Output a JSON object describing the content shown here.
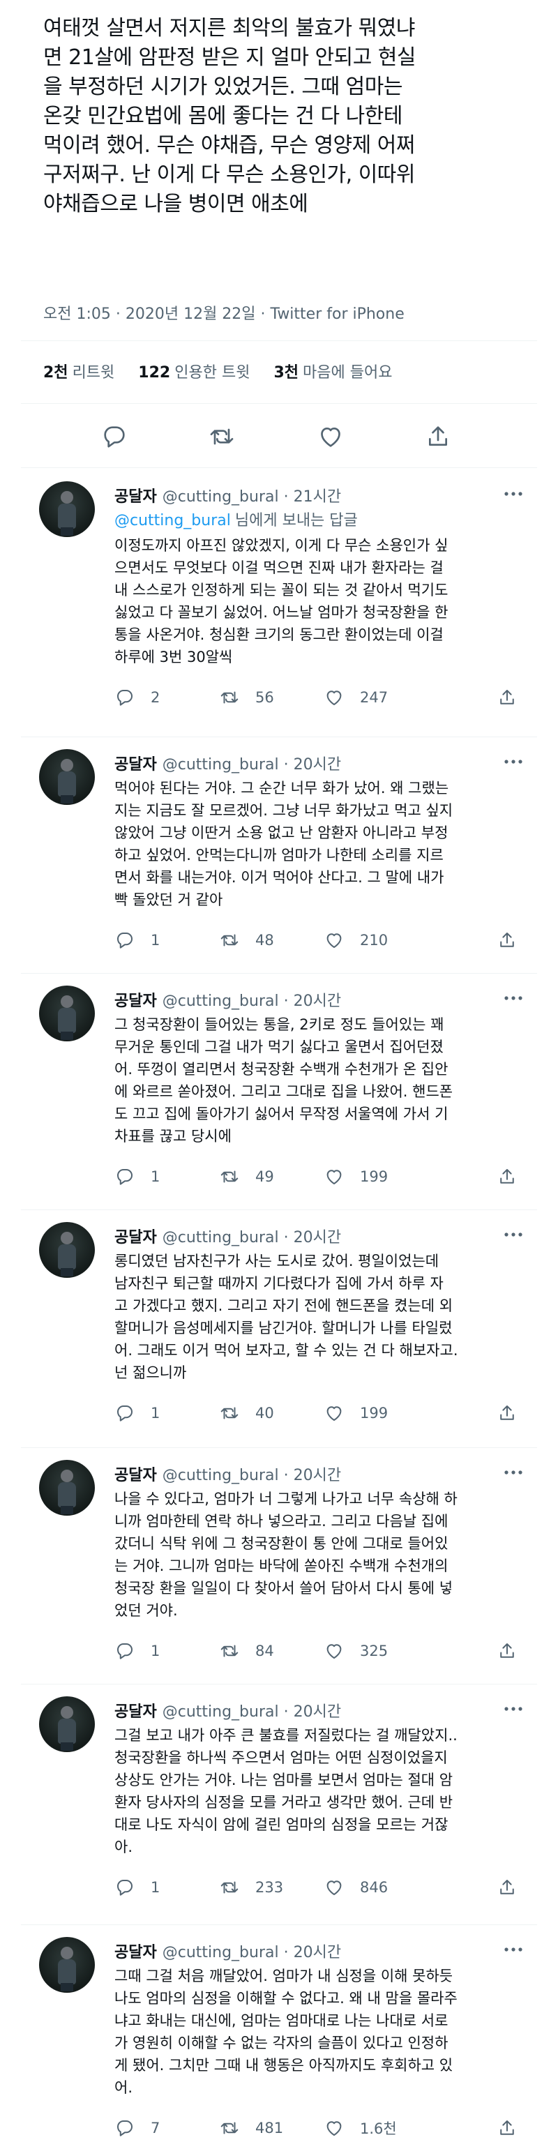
{
  "tweet": {
    "lines": [
      "여태껏 살면서 저지른 최악의 불효가 뭐였냐",
      "면 21살에 암판정 받은 지 얼마 안되고 현실",
      "을 부정하던 시기가 있었거든. 그때 엄마는",
      "온갖 민간요법에 몸에 좋다는 건 다 나한테",
      "먹이려 했어. 무슨 야채즙, 무슨 영양제 어쩌",
      "구저쩌구. 난 이게 다 무슨 소용인가, 이따위",
      "야채즙으로 나을 병이면 애초에"
    ],
    "meta": "오전 1:05 · 2020년 12월 22일 · Twitter for iPhone",
    "stats": {
      "retweets_num": "2천",
      "retweets_label": "리트윗",
      "quotes_num": "122",
      "quotes_label": "인용한 트윗",
      "likes_num": "3천",
      "likes_label": "마음에 들어요"
    }
  },
  "replies": [
    {
      "name": "공달자",
      "handle": "@cutting_bural",
      "time": "· 21시간",
      "replying_to": "@cutting_bural",
      "replying_suffix": "님에게 보내는 답글",
      "lines": [
        "이정도까지 아프진 않았겠지, 이게 다 무슨 소용인가 싶",
        "으면서도 무엇보다 이걸 먹으면 진짜 내가 환자라는 걸",
        "내 스스로가 인정하게 되는 꼴이 되는 것 같아서 먹기도",
        "싫었고 다 꼴보기 싫었어. 어느날 엄마가 청국장환을 한",
        "통을 사온거야. 청심환 크기의 동그란 환이었는데 이걸",
        "하루에 3번 30알씩"
      ],
      "replies": "2",
      "retweets": "56",
      "likes": "247"
    },
    {
      "name": "공달자",
      "handle": "@cutting_bural",
      "time": "· 20시간",
      "lines": [
        "먹어야 된다는 거야. 그 순간 너무 화가 났어. 왜 그랬는",
        "지는 지금도 잘 모르겠어. 그냥 너무 화가났고 먹고 싶지",
        "않았어 그냥 이딴거 소용 없고 난 암환자 아니라고 부정",
        "하고 싶었어. 안먹는다니까 엄마가 나한테 소리를 지르",
        "면서 화를 내는거야. 이거 먹어야 산다고. 그 말에 내가",
        "빡 돌았던 거 같아"
      ],
      "replies": "1",
      "retweets": "48",
      "likes": "210"
    },
    {
      "name": "공달자",
      "handle": "@cutting_bural",
      "time": "· 20시간",
      "lines": [
        "그 청국장환이 들어있는 통을, 2키로 정도 들어있는 꽤",
        "무거운 통인데 그걸 내가 먹기 싫다고 울면서 집어던졌",
        "어. 뚜껑이 열리면서 청국장환 수백개 수천개가 온 집안",
        "에 와르르 쏟아졌어. 그리고 그대로 집을 나왔어. 핸드폰",
        "도 끄고 집에 돌아가기 싫어서 무작정 서울역에 가서 기",
        "차표를 끊고 당시에"
      ],
      "replies": "1",
      "retweets": "49",
      "likes": "199"
    },
    {
      "name": "공달자",
      "handle": "@cutting_bural",
      "time": "· 20시간",
      "lines": [
        "롱디였던 남자친구가 사는 도시로 갔어. 평일이었는데",
        "남자친구 퇴근할 때까지 기다렸다가 집에 가서 하루 자",
        "고 가겠다고 했지. 그리고 자기 전에 핸드폰을 켰는데 외",
        "할머니가 음성메세지를 남긴거야. 할머니가 나를 타일렀",
        "어. 그래도 이거 먹어 보자고, 할 수 있는 건 다 해보자고.",
        "넌 젊으니까"
      ],
      "replies": "1",
      "retweets": "40",
      "likes": "199"
    },
    {
      "name": "공달자",
      "handle": "@cutting_bural",
      "time": "· 20시간",
      "lines": [
        "나을 수 있다고, 엄마가 너 그렇게 나가고 너무 속상해 하",
        "니까 엄마한테 연락 하나 넣으라고. 그리고 다음날 집에",
        "갔더니 식탁 위에 그 청국장환이 통 안에 그대로 들어있",
        "는 거야. 그니까 엄마는 바닥에 쏟아진 수백개 수천개의",
        "청국장 환을 일일이 다 찾아서 쓸어 담아서 다시 통에 넣",
        "었던 거야."
      ],
      "replies": "1",
      "retweets": "84",
      "likes": "325"
    },
    {
      "name": "공달자",
      "handle": "@cutting_bural",
      "time": "· 20시간",
      "lines": [
        "그걸 보고 내가 아주 큰 불효를 저질렀다는 걸 깨달았지..",
        "청국장환을 하나씩 주으면서 엄마는 어떤 심정이었을지",
        "상상도 안가는 거야. 나는 엄마를 보면서 엄마는 절대 암",
        "환자 당사자의 심정을 모를 거라고 생각만 했어. 근데 반",
        "대로 나도 자식이 암에 걸린 엄마의 심정을 모르는 거잖",
        "아."
      ],
      "replies": "1",
      "retweets": "233",
      "likes": "846"
    },
    {
      "name": "공달자",
      "handle": "@cutting_bural",
      "time": "· 20시간",
      "lines": [
        "그때 그걸 처음 깨달았어. 엄마가 내 심정을 이해 못하듯",
        "나도 엄마의 심정을 이해할 수 없다고. 왜 내 맘을 몰라주",
        "냐고 화내는 대신에, 엄마는 엄마대로 나는 나대로 서로",
        "가 영원히 이해할 수 없는 각자의 슬픔이 있다고 인정하",
        "게 됐어. 그치만 그때 내 행동은 아직까지도 후회하고 있",
        "어."
      ],
      "replies": "7",
      "retweets": "481",
      "likes": "1.6천"
    }
  ],
  "icons": {
    "reply": "reply-icon",
    "retweet": "retweet-icon",
    "like": "heart-icon",
    "share": "share-icon",
    "more": "more-icon",
    "avatar": "avatar-image"
  },
  "colors": {
    "text": "#0f1419",
    "secondary": "#536471",
    "link": "#1d9bf0",
    "divider": "#eff3f4"
  }
}
